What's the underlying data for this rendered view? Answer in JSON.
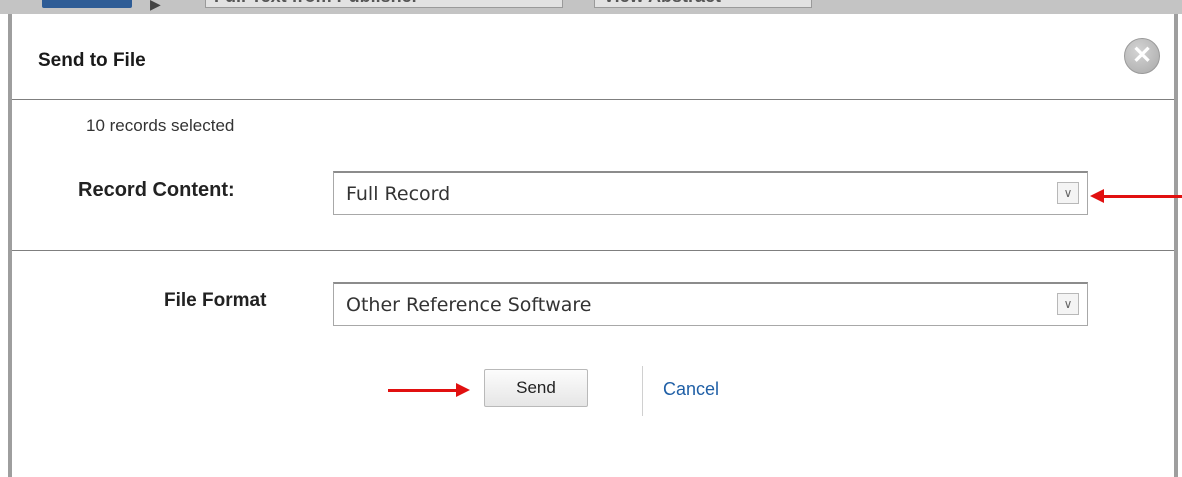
{
  "background": {
    "tab_1": "Full Text from Publisher",
    "tab_2": "View Abstract"
  },
  "dialog": {
    "title": "Send to File",
    "close_icon": "close-circle-icon",
    "records_selected": "10 records selected",
    "record_content": {
      "label": "Record Content:",
      "selected": "Full Record"
    },
    "file_format": {
      "label": "File Format",
      "selected": "Other Reference Software"
    },
    "send_label": "Send",
    "cancel_label": "Cancel"
  },
  "annotations": {
    "arrow_color": "#e11010"
  },
  "colors": {
    "link": "#1f5fa6",
    "border": "#9e9e9e"
  }
}
